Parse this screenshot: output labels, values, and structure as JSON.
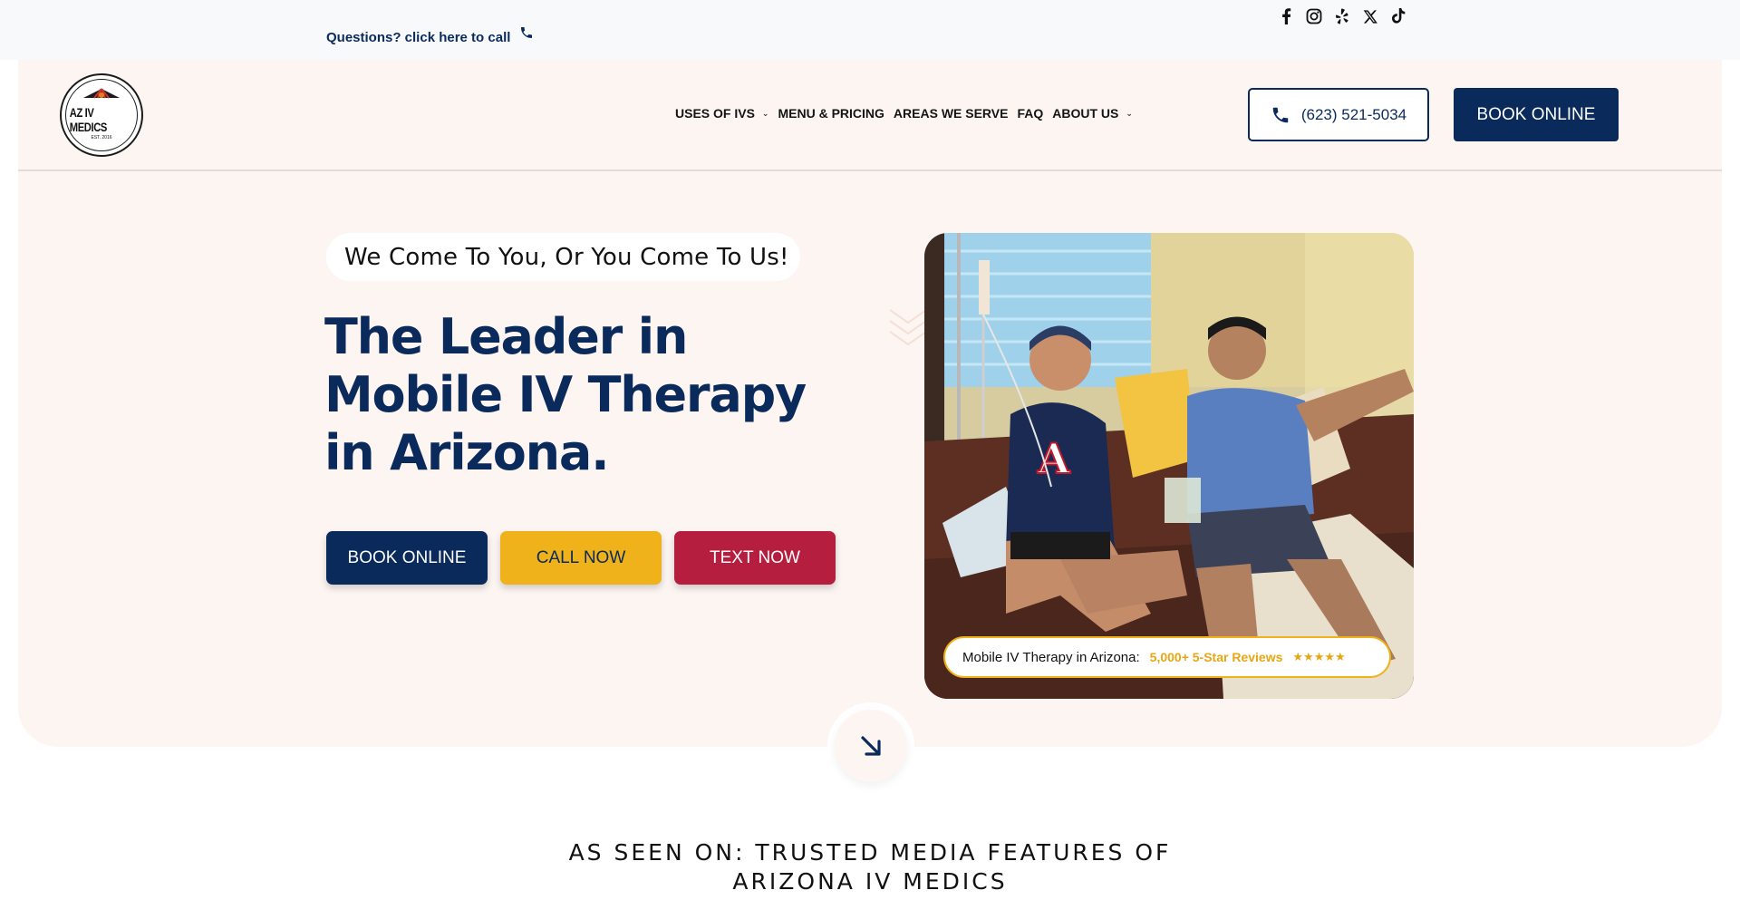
{
  "topbar": {
    "call_text": "Questions? click here to call",
    "social_icons": [
      "facebook-icon",
      "instagram-icon",
      "yelp-icon",
      "x-icon",
      "tiktok-icon"
    ]
  },
  "header": {
    "logo_text": "AZ IV MEDICS",
    "logo_est": "EST. 2016",
    "nav": {
      "uses": "USES OF IVS",
      "menu": "MENU & PRICING",
      "areas": "AREAS WE SERVE",
      "faq": "FAQ",
      "about": "ABOUT US"
    },
    "phone_label": "(623) 521-5034",
    "book_label": "BOOK ONLINE"
  },
  "hero": {
    "tagline": "We Come To You, Or You Come To Us!",
    "headline": "The Leader in Mobile IV Therapy in Arizona.",
    "buttons": {
      "book": "BOOK ONLINE",
      "call": "CALL NOW",
      "text": "TEXT NOW"
    },
    "review_label": "Mobile IV Therapy in Arizona:",
    "review_count": "5,000+ 5-Star Reviews",
    "stars": "★★★★★"
  },
  "seen_on": {
    "line1": "AS SEEN ON: TRUSTED MEDIA FEATURES OF",
    "line2": "ARIZONA IV MEDICS"
  },
  "colors": {
    "navy": "#0a2a5c",
    "gold": "#f0b21b",
    "crimson": "#b51e3e",
    "hero_bg": "#fdf5f2"
  }
}
